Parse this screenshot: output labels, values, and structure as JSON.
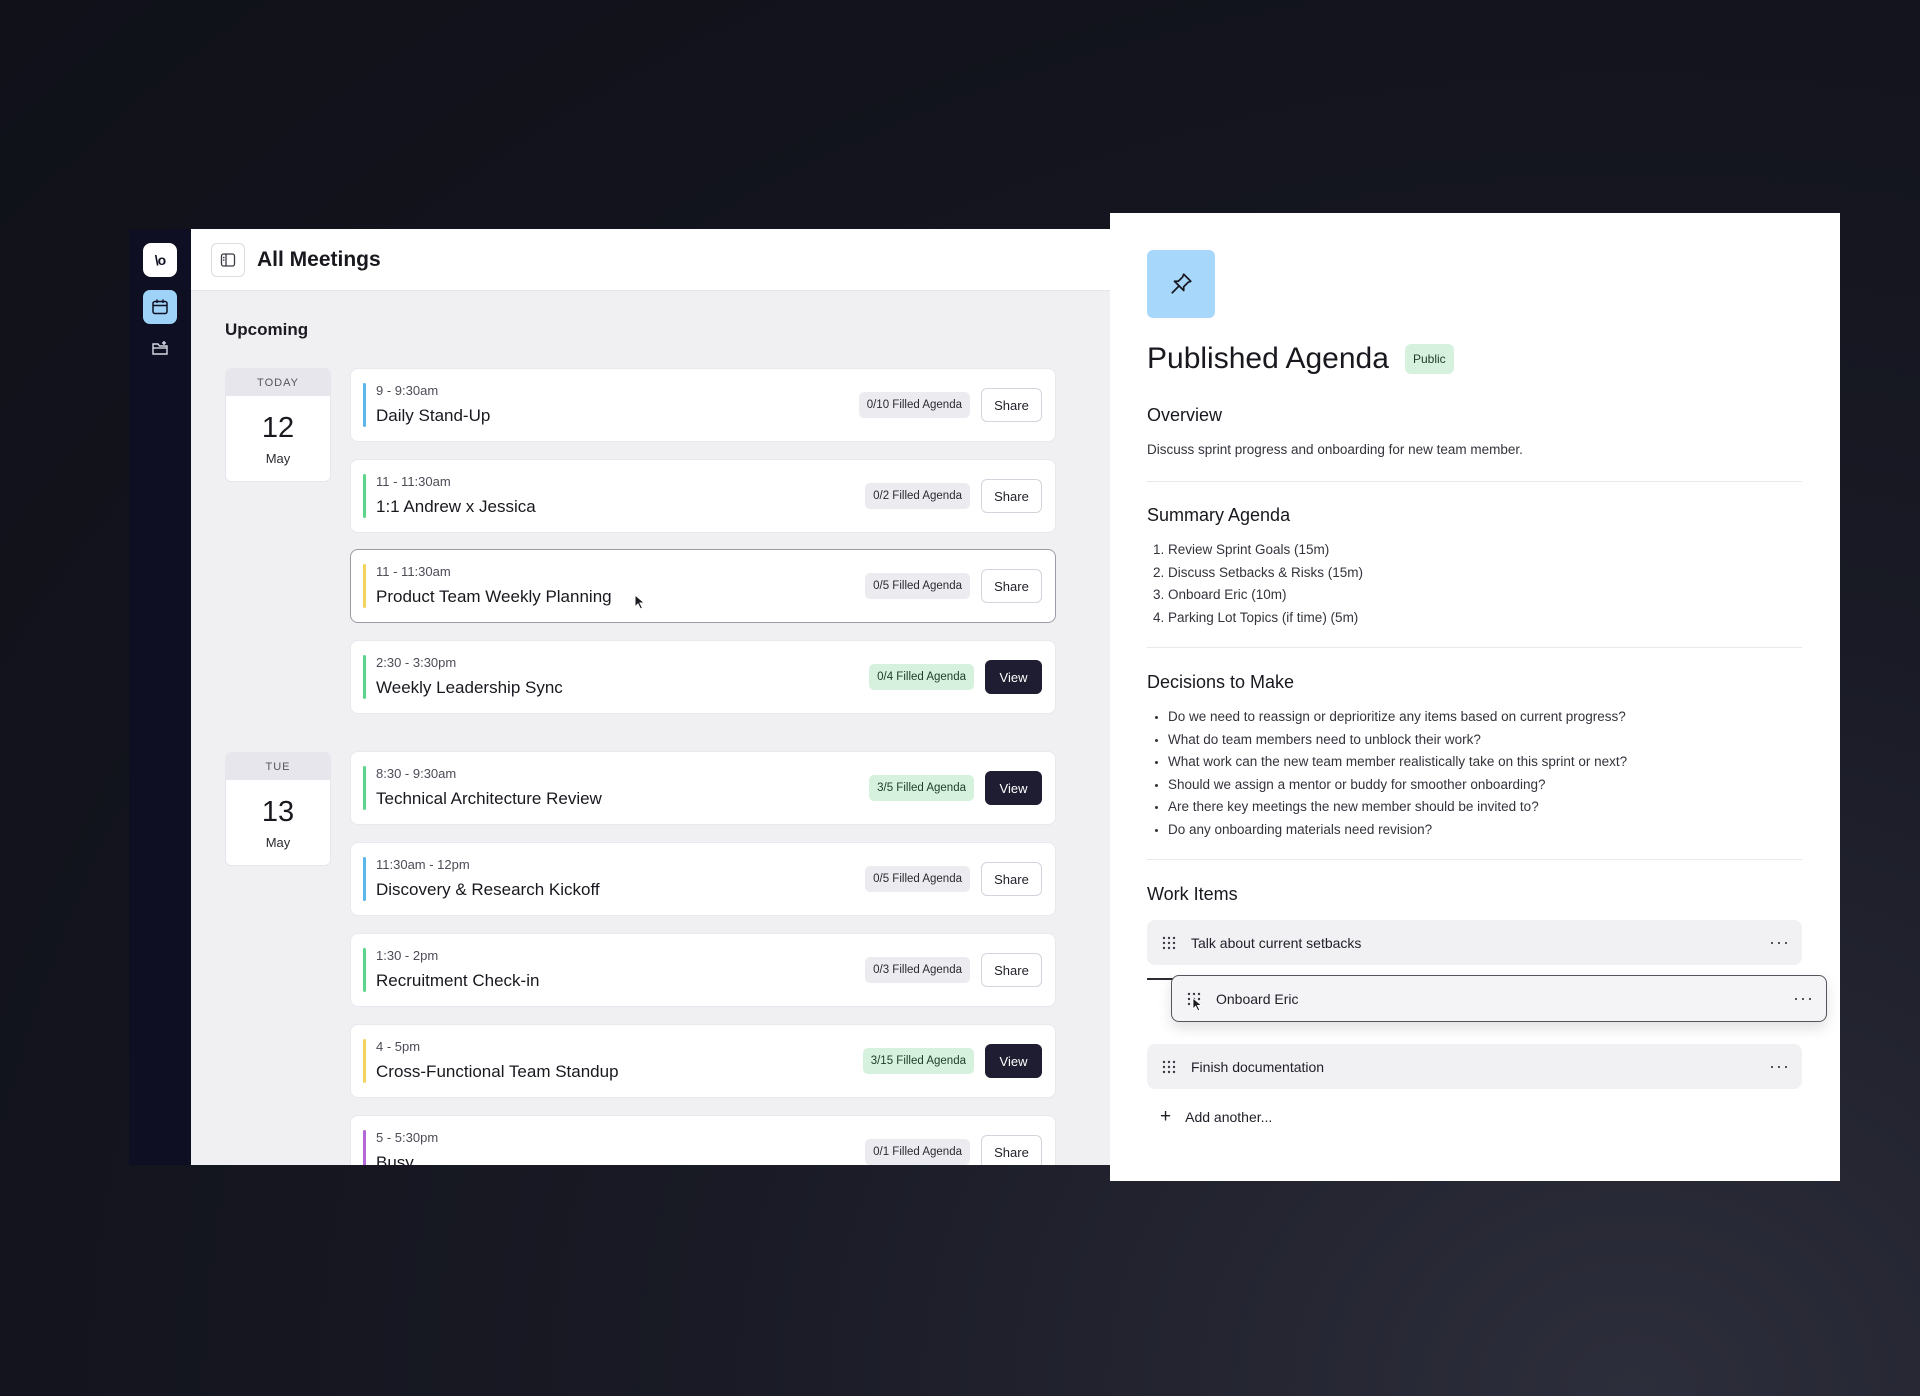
{
  "app": {
    "logo_text": "\\o",
    "title": "All Meetings",
    "section_title": "Upcoming",
    "rail_icons": [
      "calendar-icon",
      "folder-add-icon"
    ]
  },
  "days": [
    {
      "dow": "TODAY",
      "num": "12",
      "month": "May"
    },
    {
      "dow": "TUE",
      "num": "13",
      "month": "May"
    }
  ],
  "meetings": [
    {
      "time": "9 - 9:30am",
      "name": "Daily Stand-Up",
      "agenda": "0/10 Filled Agenda",
      "action": "Share",
      "bar_color": "#5bb6ea",
      "badge_style": "gray",
      "action_style": "share"
    },
    {
      "time": "11 - 11:30am",
      "name": "1:1 Andrew x Jessica",
      "agenda": "0/2 Filled Agenda",
      "action": "Share",
      "bar_color": "#5bd58a",
      "badge_style": "gray",
      "action_style": "share"
    },
    {
      "time": "11 - 11:30am",
      "name": "Product Team Weekly Planning",
      "agenda": "0/5 Filled Agenda",
      "action": "Share",
      "bar_color": "#f2d35c",
      "badge_style": "gray",
      "action_style": "share"
    },
    {
      "time": "2:30 - 3:30pm",
      "name": "Weekly Leadership Sync",
      "agenda": "0/4 Filled Agenda",
      "action": "View",
      "bar_color": "#5bd58a",
      "badge_style": "green",
      "action_style": "view"
    },
    {
      "time": "8:30 - 9:30am",
      "name": "Technical Architecture Review",
      "agenda": "3/5 Filled Agenda",
      "action": "View",
      "bar_color": "#5bd58a",
      "badge_style": "green",
      "action_style": "view"
    },
    {
      "time": "11:30am - 12pm",
      "name": "Discovery & Research Kickoff",
      "agenda": "0/5 Filled Agenda",
      "action": "Share",
      "bar_color": "#5bb6ea",
      "badge_style": "gray",
      "action_style": "share"
    },
    {
      "time": "1:30 - 2pm",
      "name": "Recruitment Check-in",
      "agenda": "0/3 Filled Agenda",
      "action": "Share",
      "bar_color": "#5bd58a",
      "badge_style": "gray",
      "action_style": "share"
    },
    {
      "time": "4 - 5pm",
      "name": "Cross-Functional Team Standup",
      "agenda": "3/15 Filled Agenda",
      "action": "View",
      "bar_color": "#f2d35c",
      "badge_style": "green",
      "action_style": "view"
    },
    {
      "time": "5 - 5:30pm",
      "name": "Busy",
      "agenda": "0/1 Filled Agenda",
      "action": "Share",
      "bar_color": "#b467d6",
      "badge_style": "gray",
      "action_style": "share"
    }
  ],
  "agenda": {
    "icon": "pushpin-icon",
    "title": "Published Agenda",
    "visibility": "Public",
    "overview_title": "Overview",
    "overview_text": "Discuss sprint progress and onboarding for new team member.",
    "summary_title": "Summary Agenda",
    "summary_items": [
      "Review Sprint Goals (15m)",
      "Discuss Setbacks & Risks (15m)",
      "Onboard Eric (10m)",
      "Parking Lot Topics (if time) (5m)"
    ],
    "decisions_title": "Decisions to Make",
    "decisions": [
      "Do we need to reassign or deprioritize any items based on current progress?",
      "What do team members need to unblock their work?",
      "What work can the new team member realistically take on this sprint or next?",
      "Should we assign a mentor or buddy for smoother onboarding?",
      "Are there key meetings the new member should be invited to?",
      "Do any onboarding materials need revision?"
    ],
    "work_items_title": "Work Items",
    "work_items": [
      "Talk about current setbacks",
      "Onboard Eric",
      "Finish documentation"
    ],
    "more_label": "···",
    "add_label": "Add another...",
    "add_icon": "+"
  },
  "colors": {
    "rail_bg": "#0e0f22",
    "rail_active": "#9fd2f7",
    "pin_bg": "#a7d8fb",
    "badge_green": "#d6f2df",
    "view_btn": "#1e1d31"
  }
}
